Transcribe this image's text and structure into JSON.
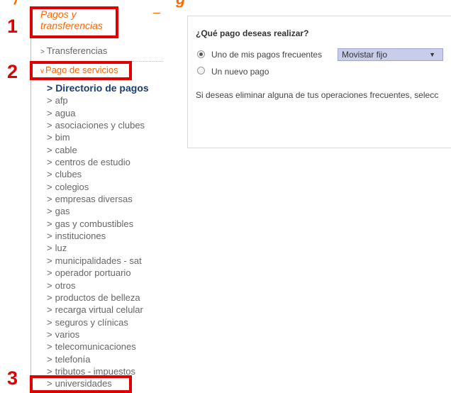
{
  "sidebar": {
    "section_title": "Pagos y transferencias",
    "collapse_symbol": "–",
    "items": [
      {
        "label": "Transferencias",
        "prefix": ">"
      },
      {
        "label": "Pago de servicios",
        "prefix": "v"
      }
    ],
    "sub_items": [
      "Directorio de pagos",
      "afp",
      "agua",
      "asociaciones y clubes",
      "bim",
      "cable",
      "centros de estudio",
      "clubes",
      "colegios",
      "empresas diversas",
      "gas",
      "gas y combustibles",
      "instituciones",
      "luz",
      "municipalidades - sat",
      "operador portuario",
      "otros",
      "productos de belleza",
      "recarga virtual celular",
      "seguros y clínicas",
      "varios",
      "telecomunicaciones",
      "telefonía",
      "tributos - impuestos",
      "universidades"
    ],
    "sub_prefix": ">"
  },
  "annotations": [
    "1",
    "2",
    "3"
  ],
  "panel": {
    "title": "¿Qué pago deseas realizar?",
    "option_frequent": "Uno de mis pagos frecuentes",
    "option_new": "Un nuevo pago",
    "selected_option": "frequent",
    "select_value": "Movistar fijo",
    "select_arrow": "▼",
    "info_text": "Si deseas eliminar alguna de tus operaciones frecuentes, selecc"
  },
  "colors": {
    "accent": "#ff6600",
    "annotation": "#e00000",
    "current_item": "#1a3c6e",
    "select_bg": "#c8cdea"
  }
}
